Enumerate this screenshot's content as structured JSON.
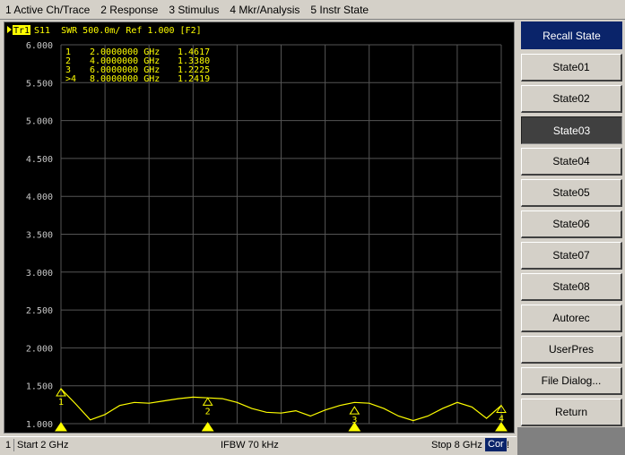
{
  "menu": [
    "1 Active Ch/Trace",
    "2 Response",
    "3 Stimulus",
    "4 Mkr/Analysis",
    "5 Instr State"
  ],
  "trace_header": {
    "tag": "Tr1",
    "text": "S11  SWR 500.0m/ Ref 1.000 [F2]"
  },
  "colors": {
    "trace": "#ffff00",
    "grid": "#555555",
    "background": "#000000",
    "scale_text": "#c8c8c8",
    "title_button": "#0a246a",
    "active_button": "#404040"
  },
  "chart_data": {
    "type": "line",
    "xlim": [
      2,
      8
    ],
    "ylim": [
      1.0,
      6.0
    ],
    "xunit": "GHz",
    "y_ticks": [
      "6.000",
      "5.500",
      "5.000",
      "4.500",
      "4.000",
      "3.500",
      "3.000",
      "2.500",
      "2.000",
      "1.500",
      "1.000"
    ],
    "series": [
      {
        "x": [
          2.0,
          2.2,
          2.4,
          2.6,
          2.8,
          3.0,
          3.2,
          3.4,
          3.6,
          3.8,
          4.0,
          4.2,
          4.4,
          4.6,
          4.8,
          5.0,
          5.2,
          5.4,
          5.6,
          5.8,
          6.0,
          6.2,
          6.4,
          6.6,
          6.8,
          7.0,
          7.2,
          7.4,
          7.6,
          7.8,
          8.0
        ],
        "y": [
          1.46,
          1.26,
          1.05,
          1.12,
          1.24,
          1.28,
          1.27,
          1.3,
          1.33,
          1.35,
          1.34,
          1.33,
          1.28,
          1.2,
          1.15,
          1.14,
          1.17,
          1.1,
          1.18,
          1.24,
          1.28,
          1.27,
          1.2,
          1.1,
          1.04,
          1.1,
          1.2,
          1.28,
          1.22,
          1.07,
          1.24
        ]
      }
    ],
    "markers": [
      {
        "id": "1",
        "label": "1",
        "freq": "2.0000000 GHz",
        "x": 2.0,
        "value": "1.4617",
        "y": 1.4617
      },
      {
        "id": "2",
        "label": "2",
        "freq": "4.0000000 GHz",
        "x": 4.0,
        "value": "1.3380",
        "y": 1.338
      },
      {
        "id": "3",
        "label": "3",
        "freq": "6.0000000 GHz",
        "x": 6.0,
        "value": "1.2225",
        "y": 1.2225
      },
      {
        "id": "4",
        "label": ">4",
        "freq": "8.0000000 GHz",
        "x": 8.0,
        "value": "1.2419",
        "y": 1.2419
      }
    ],
    "grid": true
  },
  "status": {
    "channel": "1",
    "start": "Start 2 GHz",
    "ifbw": "IFBW 70 kHz",
    "stop": "Stop 8 GHz",
    "cor": "Cor",
    "excl": "!"
  },
  "softkeys": {
    "title": "Recall State",
    "items": [
      {
        "label": "State01",
        "active": false
      },
      {
        "label": "State02",
        "active": false
      },
      {
        "label": "State03",
        "active": true
      },
      {
        "label": "State04",
        "active": false
      },
      {
        "label": "State05",
        "active": false
      },
      {
        "label": "State06",
        "active": false
      },
      {
        "label": "State07",
        "active": false
      },
      {
        "label": "State08",
        "active": false
      },
      {
        "label": "Autorec",
        "active": false
      },
      {
        "label": "UserPres",
        "active": false
      },
      {
        "label": "File Dialog...",
        "active": false
      },
      {
        "label": "Return",
        "active": false
      }
    ]
  }
}
